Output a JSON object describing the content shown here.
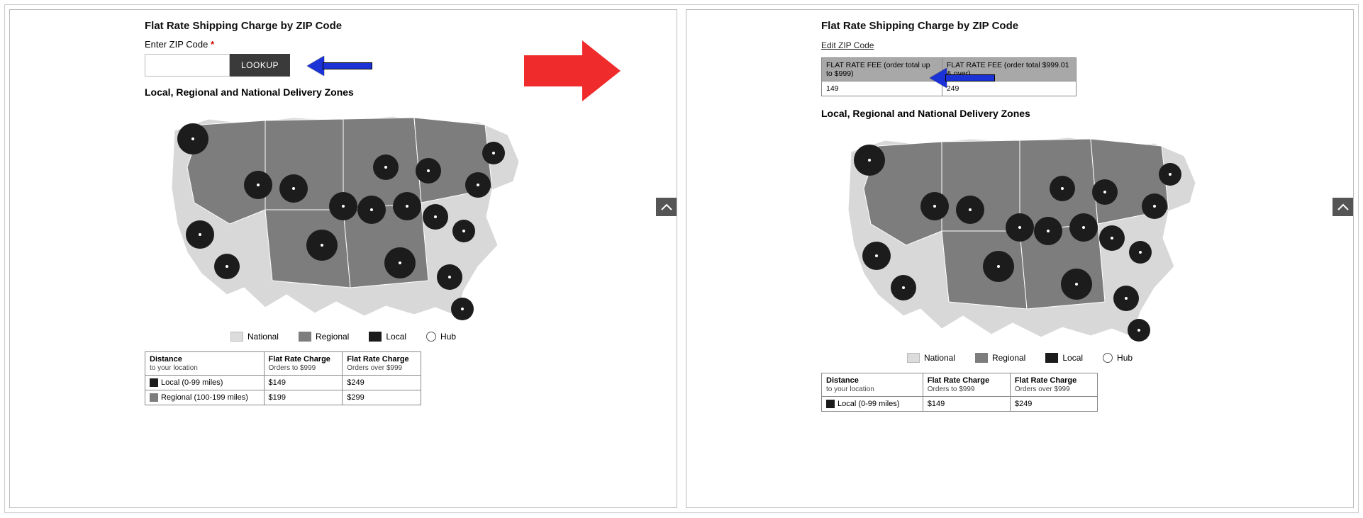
{
  "left": {
    "title": "Flat Rate Shipping Charge by ZIP Code",
    "zip_label": "Enter ZIP Code",
    "lookup": "LOOKUP",
    "zones_title": "Local, Regional and National Delivery Zones"
  },
  "right": {
    "title": "Flat Rate Shipping Charge by ZIP Code",
    "edit_link": "Edit ZIP Code",
    "fee_headers": {
      "a": "FLAT RATE FEE (order total up to $999)",
      "b": "FLAT RATE FEE (order total $999.01 & over)"
    },
    "fee_values": {
      "a": "149",
      "b": "249"
    },
    "zones_title": "Local, Regional and National Delivery Zones"
  },
  "legend": {
    "national": "National",
    "regional": "Regional",
    "local": "Local",
    "hub": "Hub"
  },
  "rate_table": {
    "headers": {
      "distance_t": "Distance",
      "distance_s": "to your location",
      "c1_t": "Flat Rate Charge",
      "c1_s": "Orders to $999",
      "c2_t": "Flat Rate Charge",
      "c2_s": "Orders over $999"
    },
    "rows": [
      {
        "zone": "local",
        "label": "Local (0-99 miles)",
        "c1": "$149",
        "c2": "$249"
      },
      {
        "zone": "regional",
        "label": "Regional (100-199 miles)",
        "c1": "$199",
        "c2": "$299"
      }
    ]
  }
}
